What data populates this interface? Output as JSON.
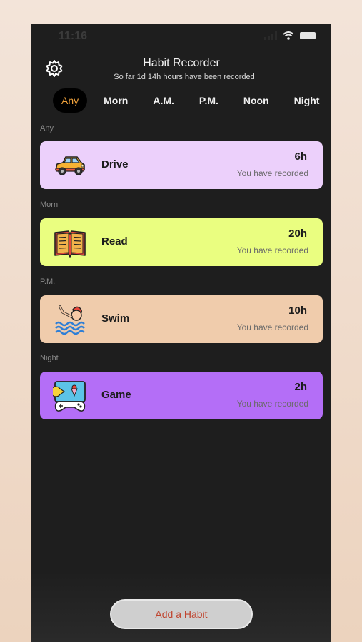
{
  "status": {
    "time": "11:16"
  },
  "header": {
    "title": "Habit Recorder",
    "subtitle": "So far 1d 14h  hours have been recorded"
  },
  "tabs": [
    {
      "label": "Any",
      "active": true
    },
    {
      "label": "Morn"
    },
    {
      "label": "A.M."
    },
    {
      "label": "P.M."
    },
    {
      "label": "Noon"
    },
    {
      "label": "Night"
    }
  ],
  "sections": [
    {
      "label": "Any",
      "habit": {
        "name": "Drive",
        "hours": "6h",
        "caption": "You have recorded",
        "color": "#ecd0fb",
        "icon": "car-icon"
      }
    },
    {
      "label": "Morn",
      "habit": {
        "name": "Read",
        "hours": "20h",
        "caption": "You have recorded",
        "color": "#eafe80",
        "icon": "book-icon"
      }
    },
    {
      "label": "P.M.",
      "habit": {
        "name": "Swim",
        "hours": "10h",
        "caption": "You have recorded",
        "color": "#f0ccac",
        "icon": "swimmer-icon"
      }
    },
    {
      "label": "Night",
      "habit": {
        "name": "Game",
        "hours": "2h",
        "caption": "You have recorded",
        "color": "#b46ef7",
        "icon": "game-icon"
      }
    }
  ],
  "footer": {
    "add_label": "Add a Habit"
  },
  "colors": {
    "accent": "#f0a23c",
    "add_text": "#c0442e",
    "background": "#1e1e1e"
  }
}
